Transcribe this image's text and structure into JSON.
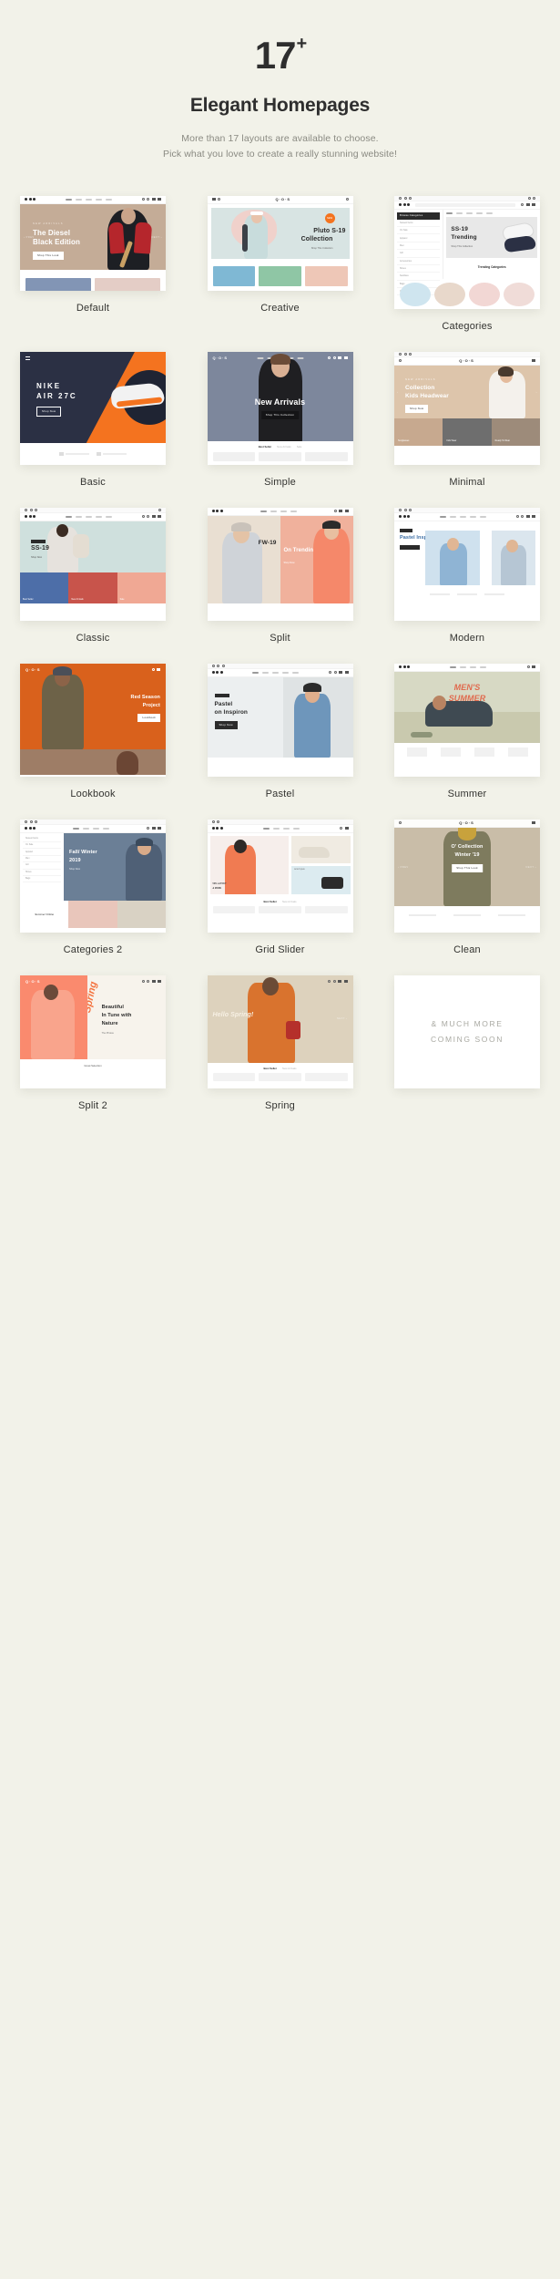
{
  "hero": {
    "count": "17",
    "count_sup": "+",
    "title": "Elegant Homepages",
    "sub_line1": "More than 17 layouts are available to choose.",
    "sub_line2": "Pick what you love to create a really stunning website!"
  },
  "colors": {
    "page_bg": "#f2f2e9",
    "card_bg": "#ffffff",
    "text_dark": "#2e2e2e",
    "text_muted": "#8a8a82",
    "accent_orange": "#f4731f",
    "accent_coral": "#fa8a6e",
    "navy": "#2b3044",
    "tan": "#c4ac97",
    "slate": "#7d879c",
    "mint": "#cfe0dd",
    "sand": "#e4d9c6"
  },
  "brand": "Q·O·S",
  "items": [
    {
      "id": "default",
      "label": "Default",
      "hero_eyebrow": "New Arrivals",
      "hero_title_1": "The Diesel",
      "hero_title_2": "Black Edition",
      "cta": "Shop This Look",
      "bg": "#c4ac97"
    },
    {
      "id": "creative",
      "label": "Creative",
      "hero_title_1": "Pluto S-19",
      "hero_title_2": "Collection",
      "cta": "Shop This Collection",
      "bg": "#d8e4e3",
      "badge": "NEW"
    },
    {
      "id": "categories",
      "label": "Categories",
      "hero_title_1": "SS-19",
      "hero_title_2": "Trending",
      "cta": "Shop This Collection",
      "section_title": "Trending Categories",
      "sidebar_title": "Browse Categories",
      "sidebar_items": [
        "Newest Items",
        "On Sale",
        "Apparel",
        "Men",
        "Girl",
        "Accessories",
        "Shoes",
        "Necklace",
        "Bags",
        "Others"
      ],
      "bg": "#efefef"
    },
    {
      "id": "basic",
      "label": "Basic",
      "hero_title_1": "NIKE",
      "hero_title_2": "AIR 27C",
      "cta": "Shop Now",
      "bg": "#2b3044"
    },
    {
      "id": "simple",
      "label": "Simple",
      "hero_title_1": "New Arrivals",
      "cta": "Shop This Collection",
      "bg": "#7d879c",
      "footer_tabs": [
        "Best Seller",
        "New Arrivals",
        "Sale"
      ]
    },
    {
      "id": "minimal",
      "label": "Minimal",
      "hero_eyebrow": "New Arrivals",
      "hero_title_1": "Collection",
      "hero_title_2": "Kids Headwear",
      "cta": "Shop Now",
      "bg": "#ddc5ab"
    },
    {
      "id": "classic",
      "label": "Classic",
      "hero_title_1": "SS-19",
      "cta": "Shop Now",
      "bg": "#cfe0dd",
      "footer_tabs": [
        "Best Seller",
        "New Arrivals"
      ]
    },
    {
      "id": "split",
      "label": "Split",
      "hero_title_1": "FW-19",
      "hero_title_2": "On Trending",
      "cta": "Shop Now",
      "bg": "#e9dfd2"
    },
    {
      "id": "modern",
      "label": "Modern",
      "hero_title_1": "Pastel Inspiron",
      "cta": "Shop Now",
      "bg": "#f5f5f5"
    },
    {
      "id": "lookbook",
      "label": "Lookbook",
      "hero_title_1": "Red Season",
      "hero_title_2": "Project",
      "cta": "Lookbook",
      "bg": "#d9611c"
    },
    {
      "id": "pastel",
      "label": "Pastel",
      "hero_title_1": "Pastel",
      "hero_title_2": "on Inspiron",
      "cta": "Shop Now",
      "bg": "#eceff0"
    },
    {
      "id": "summer",
      "label": "Summer",
      "hero_title_1": "MEN'S",
      "hero_title_2": "SUMMER",
      "bg": "#d7d9c4"
    },
    {
      "id": "categories2",
      "label": "Categories 2",
      "hero_title_1": "Fall/ Winter",
      "hero_title_2": "2019",
      "cta": "Shop Now",
      "section_title": "Summer Online",
      "bg": "#6b7f96"
    },
    {
      "id": "gridslider",
      "label": "Grid Slider",
      "hero_title_1": "50% LAYOUT",
      "hero_title_2": "& MORE",
      "cta": "Shop Now",
      "side_label": "BOUTIQUE",
      "footer_tabs": [
        "Best Seller",
        "New Arrivals"
      ],
      "bg": "#f6eeeb"
    },
    {
      "id": "clean",
      "label": "Clean",
      "hero_title_1": "O' Collection",
      "hero_title_2": "Winter '19",
      "cta": "Shop This Look",
      "bg": "#c9bda8"
    },
    {
      "id": "split2",
      "label": "Split 2",
      "hero_script": "Spring",
      "hero_title_1": "Beautiful",
      "hero_title_2": "In Tune with",
      "hero_title_3": "Nature",
      "cta": "The Photos",
      "footer_note": "Great Selection",
      "bg": "#fa8a6e"
    },
    {
      "id": "spring",
      "label": "Spring",
      "hero_script": "Hello Spring!",
      "footer_tabs": [
        "Best Seller",
        "New Arrivals"
      ],
      "bg": "#ddd2bd"
    }
  ],
  "coming_soon": {
    "line1": "& MUCH MORE",
    "line2": "COMING SOON"
  }
}
